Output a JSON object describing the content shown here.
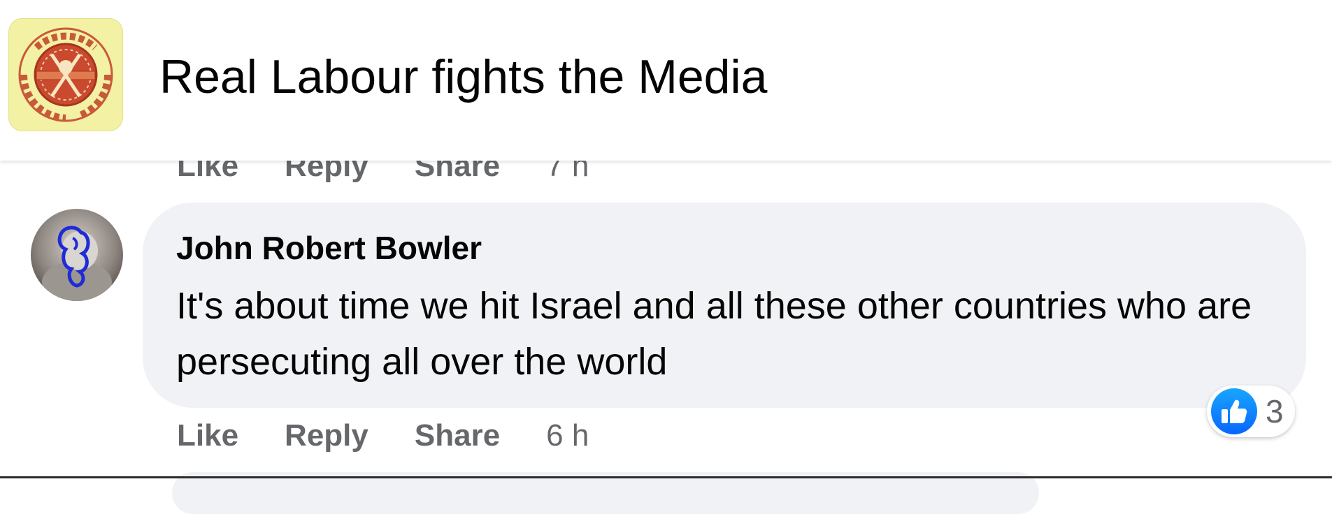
{
  "header": {
    "page_name": "Real Labour fights the Media",
    "logo_icon": "real-labour-logo"
  },
  "previous_comment": {
    "actions": {
      "like": "Like",
      "reply": "Reply",
      "share": "Share",
      "time": "7 h"
    }
  },
  "comment": {
    "author": "John Robert Bowler",
    "text": "It's about time we hit Israel and all these other countries who are persecuting all over the world",
    "avatar_icon": "user-avatar",
    "reactions": {
      "icon": "like-reaction-icon",
      "count": "3"
    },
    "actions": {
      "like": "Like",
      "reply": "Reply",
      "share": "Share",
      "time": "6 h"
    }
  },
  "colors": {
    "bubble_background": "#f0f2f5",
    "secondary_text": "#65676b",
    "like_blue": "#0866ff",
    "logo_background": "#f3f1a4"
  }
}
